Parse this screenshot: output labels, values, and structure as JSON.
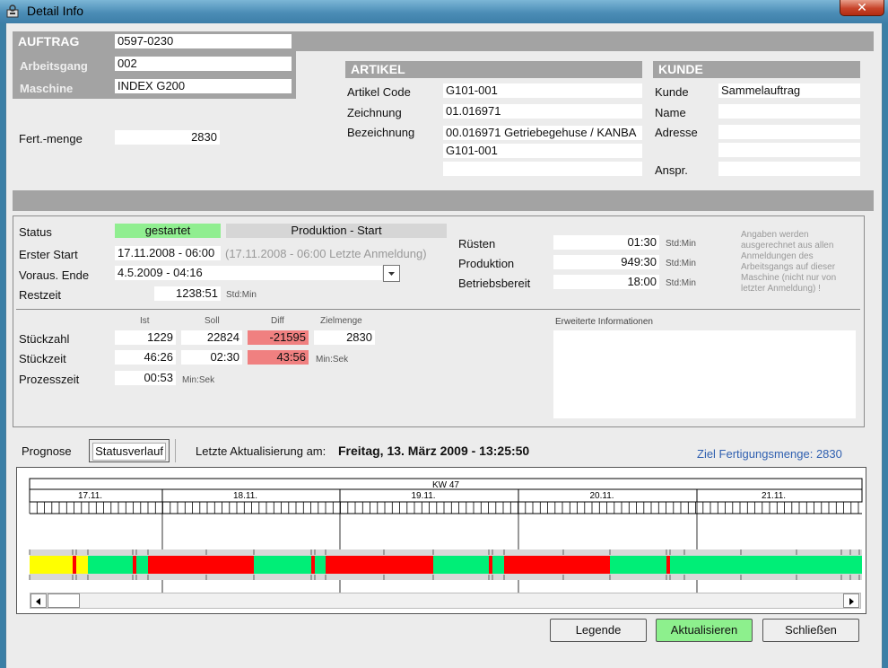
{
  "window": {
    "title": "Detail Info",
    "close_glyph": "✕"
  },
  "auftrag": {
    "header": "AUFTRAG",
    "number": "0597-0230",
    "arbeitsgang_label": "Arbeitsgang",
    "arbeitsgang": "002",
    "maschine_label": "Maschine",
    "maschine": "INDEX G200",
    "fertmenge_label": "Fert.-menge",
    "fertmenge": "2830"
  },
  "artikel": {
    "header": "ARTIKEL",
    "code_label": "Artikel Code",
    "code": "G101-001",
    "zeichnung_label": "Zeichnung",
    "zeichnung": "01.016971",
    "bezeichnung_label": "Bezeichnung",
    "bezeichnung1": "00.016971 Getriebegehuse / KANBA",
    "bezeichnung2": "G101-001",
    "bezeichnung3": ""
  },
  "kunde": {
    "header": "KUNDE",
    "kunde_label": "Kunde",
    "kunde": "Sammelauftrag",
    "name_label": "Name",
    "name": "",
    "adresse_label": "Adresse",
    "adresse1": "",
    "adresse2": "",
    "anspr_label": "Anspr.",
    "anspr": ""
  },
  "status": {
    "status_label": "Status",
    "status_value": "gestartet",
    "status_color": "#90ee90",
    "phase_value": "Produktion - Start",
    "erster_start_label": "Erster Start",
    "erster_start": "17.11.2008 - 06:00",
    "erster_start_note": "(17.11.2008 - 06:00  Letzte Anmeldung)",
    "voraus_ende_label": "Voraus. Ende",
    "voraus_ende": "4.5.2009 - 04:16",
    "restzeit_label": "Restzeit",
    "restzeit": "1238:51",
    "restzeit_unit": "Std:Min"
  },
  "zeiten": {
    "ruesten_label": "Rüsten",
    "ruesten": "01:30",
    "produktion_label": "Produktion",
    "produktion": "949:30",
    "betriebsbereit_label": "Betriebsbereit",
    "betriebsbereit": "18:00",
    "unit": "Std:Min",
    "note": "Angaben werden ausgerechnet aus allen Anmeldungen des Arbeitsgangs auf dieser Maschine (nicht nur von letzter Anmeldung) !"
  },
  "mengen": {
    "col_ist": "Ist",
    "col_soll": "Soll",
    "col_diff": "Diff",
    "col_zielmenge": "Zielmenge",
    "stueckzahl_label": "Stückzahl",
    "stueckzahl_ist": "1229",
    "stueckzahl_soll": "22824",
    "stueckzahl_diff": "-21595",
    "stueckzahl_ziel": "2830",
    "stueckzeit_label": "Stückzeit",
    "stueckzeit_ist": "46:26",
    "stueckzeit_soll": "02:30",
    "stueckzeit_diff": "43:56",
    "stueckzeit_unit": "Min:Sek",
    "prozesszeit_label": "Prozesszeit",
    "prozesszeit": "00:53",
    "prozesszeit_unit": "Min:Sek",
    "diff_color": "#f08080"
  },
  "erweitert": {
    "label": "Erweiterte Informationen",
    "text": ""
  },
  "tabs": {
    "prognose": "Prognose",
    "statusverlauf": "Statusverlauf"
  },
  "update": {
    "prefix": "Letzte Aktualisierung am:",
    "value": "Freitag, 13. März 2009 - 13:25:50"
  },
  "ziel": "Ziel Fertigungsmenge: 2830",
  "timeline": {
    "week": "KW 47",
    "days": [
      "17.11.",
      "18.11.",
      "19.11.",
      "20.11.",
      "21.11."
    ],
    "colors": {
      "yellow": "#ffff00",
      "red": "#ff0000",
      "green": "#00ee77"
    }
  },
  "buttons": {
    "legende": "Legende",
    "aktualisieren": "Aktualisieren",
    "schliessen": "Schließen"
  }
}
